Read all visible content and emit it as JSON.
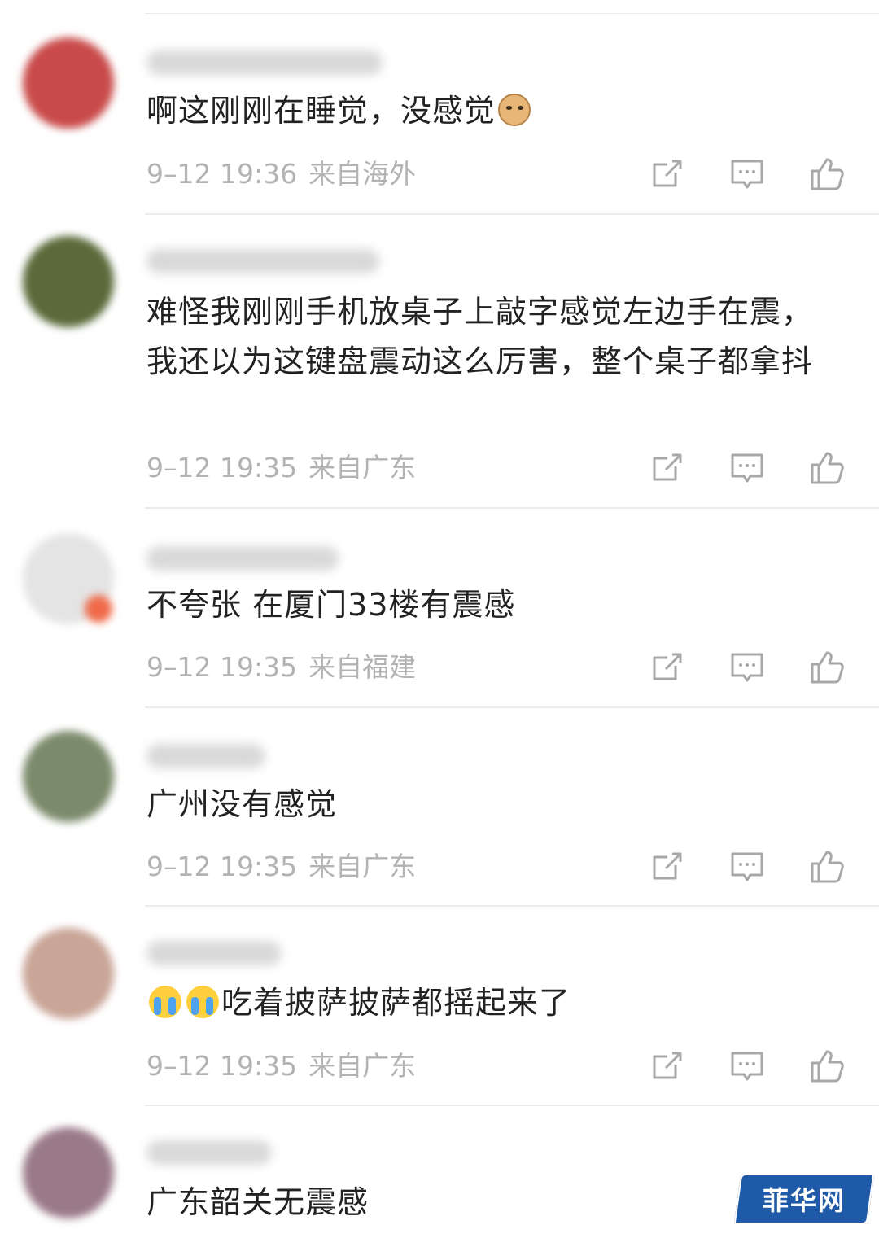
{
  "comments": [
    {
      "text": "啊这刚刚在睡觉，没感觉",
      "emoji_after": "doge-emoji",
      "time": "9–12 19:36",
      "source": "来自海外",
      "avatar_color": "#c94a4a"
    },
    {
      "text": "难怪我刚刚手机放桌子上敲字感觉左边手在震，我还以为这键盘震动这么厉害，整个桌子都拿抖",
      "time": "9–12 19:35",
      "source": "来自广东",
      "avatar_color": "#5a6a3a"
    },
    {
      "text": "不夸张 在厦门33楼有震感",
      "time": "9–12 19:35",
      "source": "来自福建",
      "avatar_color": "#e4e4e4"
    },
    {
      "text": "广州没有感觉",
      "time": "9–12 19:35",
      "source": "来自广东",
      "avatar_color": "#7a8a6a"
    },
    {
      "text": "吃着披萨披萨都摇起来了",
      "emoji_before": [
        "crying-emoji",
        "crying-emoji"
      ],
      "time": "9–12 19:35",
      "source": "来自广东",
      "avatar_color": "#c9a497"
    },
    {
      "text": "广东韶关无震感",
      "avatar_color": "#9a7a88"
    }
  ],
  "icons": {
    "share": "share-icon",
    "reply": "comment-icon",
    "like": "thumbs-up-icon"
  },
  "colors": {
    "text": "#222222",
    "meta": "#b3b3b3",
    "icon": "#a8a8a8",
    "divider": "#ececec",
    "watermark_bg": "#1f5aa8"
  },
  "watermark": {
    "text": "菲华网"
  }
}
